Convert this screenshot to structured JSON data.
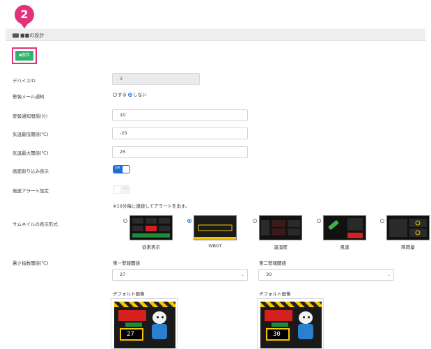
{
  "header": {
    "title": "■■の設計"
  },
  "callout": {
    "number": "2"
  },
  "toolbar": {
    "save_label": "■保存"
  },
  "fields": {
    "device_id": {
      "label": "デバイスID",
      "value": "2"
    },
    "mail_notify": {
      "label": "警報メール通知",
      "options": [
        "する",
        "しない"
      ],
      "selected": "しない"
    },
    "notify_interval": {
      "label": "警報通知間隔(分)",
      "value": "10"
    },
    "temp_min": {
      "label": "気温最低閾値(℃)",
      "value": "-20"
    },
    "temp_max": {
      "label": "気温最大閾値(℃)",
      "value": "25"
    },
    "crop_display": {
      "label": "画面割り込み表示",
      "state_text": "ON"
    },
    "wind_alert": {
      "label": "風速アラート設定",
      "state_text": "OFF",
      "note": "※10分毎に連続してアラートを出す。"
    }
  },
  "thumbnails": {
    "label": "サムネイルの表示形式",
    "selected": "WBGT",
    "items": [
      {
        "name": "従来表示"
      },
      {
        "name": "WBGT"
      },
      {
        "name": "温湿度"
      },
      {
        "name": "風速"
      },
      {
        "name": "降雨量"
      }
    ]
  },
  "heat_index": {
    "label": "暑さ指数閾値(℃)",
    "first": {
      "label": "第一警報閾値",
      "value": "27",
      "image_label": "デフォルト画像",
      "image_value": "27"
    },
    "second": {
      "label": "第二警報閾値",
      "value": "30",
      "image_label": "デフォルト画像",
      "image_value": "30"
    }
  },
  "colors": {
    "accent": "#e4327a",
    "save": "#2fb56b",
    "toggle": "#1f6fd6"
  }
}
